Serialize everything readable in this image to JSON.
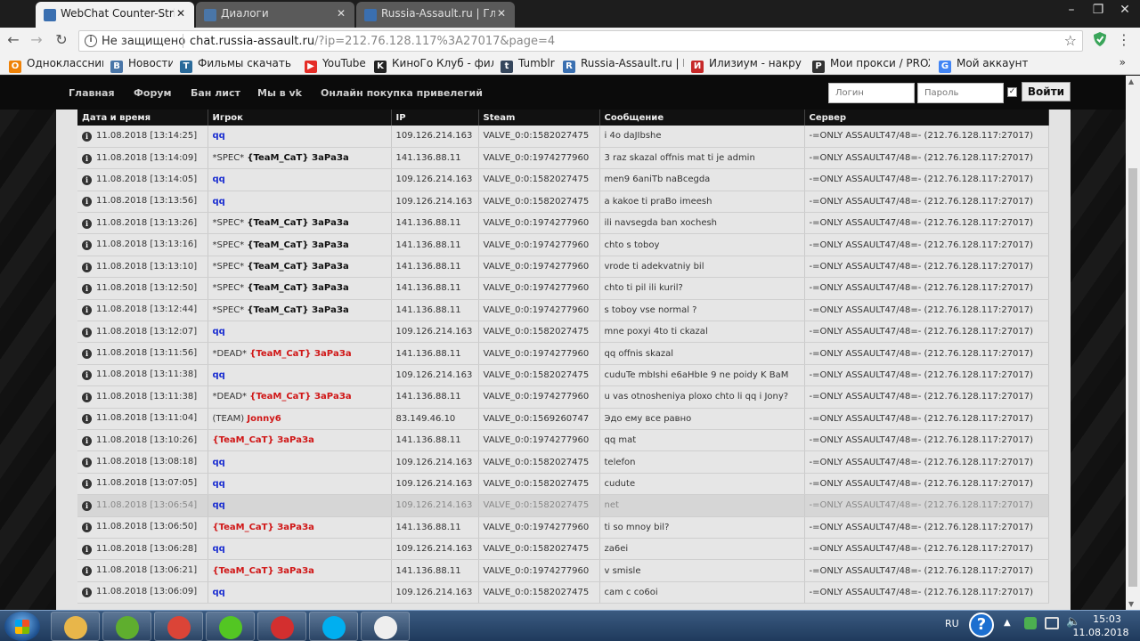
{
  "browser": {
    "tabs": [
      {
        "title": "WebChat Counter-Strike",
        "active": true,
        "favicon_color": "#3a6fb0"
      },
      {
        "title": "Диалоги",
        "active": false,
        "favicon_color": "#4a76a8"
      },
      {
        "title": "Russia-Assault.ru | Глав",
        "active": false,
        "favicon_color": "#3a6fb0"
      }
    ],
    "address": {
      "security": "Не защищено",
      "host": "chat.russia-assault.ru",
      "path": "/?ip=212.76.128.117%3A27017&page=4"
    },
    "bookmarks": [
      {
        "label": "Одноклассники",
        "color": "#ee8208",
        "glyph": "О"
      },
      {
        "label": "Новости",
        "color": "#4a76a8",
        "glyph": "В"
      },
      {
        "label": "Фильмы скачать тор",
        "color": "#2a6a9a",
        "glyph": "T"
      },
      {
        "label": "YouTube",
        "color": "#e52d27",
        "glyph": "▶"
      },
      {
        "label": "КиноГо Клуб - филь",
        "color": "#222222",
        "glyph": "K"
      },
      {
        "label": "Tumblr",
        "color": "#35465c",
        "glyph": "t"
      },
      {
        "label": "Russia-Assault.ru | Мс",
        "color": "#3a6fb0",
        "glyph": "R"
      },
      {
        "label": "Илизиум - накрутка",
        "color": "#c62828",
        "glyph": "И"
      },
      {
        "label": "Мои прокси / PROXY",
        "color": "#333333",
        "glyph": "P"
      },
      {
        "label": "Мой аккаунт",
        "color": "#4285f4",
        "glyph": "G"
      }
    ],
    "bookmarks_more": "»"
  },
  "site": {
    "nav": [
      "Главная",
      "Форум",
      "Бан лист",
      "Мы в vk",
      "Онлайн покупка привелегий"
    ],
    "login_placeholder": "Логин",
    "password_placeholder": "Пароль",
    "login_button": "Войти"
  },
  "table": {
    "headers": [
      "Дата и время",
      "Игрок",
      "IP",
      "Steam",
      "Сообщение",
      "Сервер"
    ],
    "rows": [
      {
        "time": "11.08.2018 [13:14:25]",
        "prefix": "",
        "player": "qq",
        "color": "blue",
        "ip": "109.126.214.163",
        "steam": "VALVE_0:0:1582027475",
        "msg": "i 4o daJIbshe",
        "server": "-=ONLY ASSAULT47/48=- (212.76.128.117:27017)"
      },
      {
        "time": "11.08.2018 [13:14:09]",
        "prefix": "*SPEC* ",
        "player": "{TeaM_CaT} ЗаРаЗа",
        "color": "black",
        "ip": "141.136.88.11",
        "steam": "VALVE_0:0:1974277960",
        "msg": "3 raz skazal offnis mat ti je admin",
        "server": "-=ONLY ASSAULT47/48=- (212.76.128.117:27017)"
      },
      {
        "time": "11.08.2018 [13:14:05]",
        "prefix": "",
        "player": "qq",
        "color": "blue",
        "ip": "109.126.214.163",
        "steam": "VALVE_0:0:1582027475",
        "msg": "men9 6aniTb naBcegda",
        "server": "-=ONLY ASSAULT47/48=- (212.76.128.117:27017)"
      },
      {
        "time": "11.08.2018 [13:13:56]",
        "prefix": "",
        "player": "qq",
        "color": "blue",
        "ip": "109.126.214.163",
        "steam": "VALVE_0:0:1582027475",
        "msg": "a kakoe ti praBo imeesh",
        "server": "-=ONLY ASSAULT47/48=- (212.76.128.117:27017)"
      },
      {
        "time": "11.08.2018 [13:13:26]",
        "prefix": "*SPEC* ",
        "player": "{TeaM_CaT} ЗаРаЗа",
        "color": "black",
        "ip": "141.136.88.11",
        "steam": "VALVE_0:0:1974277960",
        "msg": "ili navsegda ban xochesh",
        "server": "-=ONLY ASSAULT47/48=- (212.76.128.117:27017)"
      },
      {
        "time": "11.08.2018 [13:13:16]",
        "prefix": "*SPEC* ",
        "player": "{TeaM_CaT} ЗаРаЗа",
        "color": "black",
        "ip": "141.136.88.11",
        "steam": "VALVE_0:0:1974277960",
        "msg": "chto s toboy",
        "server": "-=ONLY ASSAULT47/48=- (212.76.128.117:27017)"
      },
      {
        "time": "11.08.2018 [13:13:10]",
        "prefix": "*SPEC* ",
        "player": "{TeaM_CaT} ЗаРаЗа",
        "color": "black",
        "ip": "141.136.88.11",
        "steam": "VALVE_0:0:1974277960",
        "msg": "vrode ti adekvatniy bil",
        "server": "-=ONLY ASSAULT47/48=- (212.76.128.117:27017)"
      },
      {
        "time": "11.08.2018 [13:12:50]",
        "prefix": "*SPEC* ",
        "player": "{TeaM_CaT} ЗаРаЗа",
        "color": "black",
        "ip": "141.136.88.11",
        "steam": "VALVE_0:0:1974277960",
        "msg": "chto ti pil ili kuril?",
        "server": "-=ONLY ASSAULT47/48=- (212.76.128.117:27017)"
      },
      {
        "time": "11.08.2018 [13:12:44]",
        "prefix": "*SPEC* ",
        "player": "{TeaM_CaT} ЗаРаЗа",
        "color": "black",
        "ip": "141.136.88.11",
        "steam": "VALVE_0:0:1974277960",
        "msg": "s toboy vse normal ?",
        "server": "-=ONLY ASSAULT47/48=- (212.76.128.117:27017)"
      },
      {
        "time": "11.08.2018 [13:12:07]",
        "prefix": "",
        "player": "qq",
        "color": "blue",
        "ip": "109.126.214.163",
        "steam": "VALVE_0:0:1582027475",
        "msg": "mne poxyi 4to ti ckazal",
        "server": "-=ONLY ASSAULT47/48=- (212.76.128.117:27017)"
      },
      {
        "time": "11.08.2018 [13:11:56]",
        "prefix": "*DEAD* ",
        "player": "{TeaM_CaT} ЗаРаЗа",
        "color": "red",
        "ip": "141.136.88.11",
        "steam": "VALVE_0:0:1974277960",
        "msg": "qq offnis skazal",
        "server": "-=ONLY ASSAULT47/48=- (212.76.128.117:27017)"
      },
      {
        "time": "11.08.2018 [13:11:38]",
        "prefix": "",
        "player": "qq",
        "color": "blue",
        "ip": "109.126.214.163",
        "steam": "VALVE_0:0:1582027475",
        "msg": "cuduTe mbIshi e6aHbIe 9 ne poidy K BaM",
        "server": "-=ONLY ASSAULT47/48=- (212.76.128.117:27017)"
      },
      {
        "time": "11.08.2018 [13:11:38]",
        "prefix": "*DEAD* ",
        "player": "{TeaM_CaT} ЗаРаЗа",
        "color": "red",
        "ip": "141.136.88.11",
        "steam": "VALVE_0:0:1974277960",
        "msg": "u vas otnosheniya ploxo chto li qq i Jony?",
        "server": "-=ONLY ASSAULT47/48=- (212.76.128.117:27017)"
      },
      {
        "time": "11.08.2018 [13:11:04]",
        "prefix": "(TEAM) ",
        "player": "Jonny6",
        "color": "red",
        "ip": "83.149.46.10",
        "steam": "VALVE_0:0:1569260747",
        "msg": "Эдо ему все равно",
        "server": "-=ONLY ASSAULT47/48=- (212.76.128.117:27017)"
      },
      {
        "time": "11.08.2018 [13:10:26]",
        "prefix": "",
        "player": "{TeaM_CaT} ЗаРаЗа",
        "color": "red",
        "ip": "141.136.88.11",
        "steam": "VALVE_0:0:1974277960",
        "msg": "qq mat",
        "server": "-=ONLY ASSAULT47/48=- (212.76.128.117:27017)"
      },
      {
        "time": "11.08.2018 [13:08:18]",
        "prefix": "",
        "player": "qq",
        "color": "blue",
        "ip": "109.126.214.163",
        "steam": "VALVE_0:0:1582027475",
        "msg": "telefon",
        "server": "-=ONLY ASSAULT47/48=- (212.76.128.117:27017)"
      },
      {
        "time": "11.08.2018 [13:07:05]",
        "prefix": "",
        "player": "qq",
        "color": "blue",
        "ip": "109.126.214.163",
        "steam": "VALVE_0:0:1582027475",
        "msg": "cudute",
        "server": "-=ONLY ASSAULT47/48=- (212.76.128.117:27017)"
      },
      {
        "time": "11.08.2018 [13:06:54]",
        "prefix": "",
        "player": "qq",
        "color": "blue",
        "ip": "109.126.214.163",
        "steam": "VALVE_0:0:1582027475",
        "msg": "net",
        "server": "-=ONLY ASSAULT47/48=- (212.76.128.117:27017)",
        "highlight": true
      },
      {
        "time": "11.08.2018 [13:06:50]",
        "prefix": "",
        "player": "{TeaM_CaT} ЗаРаЗа",
        "color": "red",
        "ip": "141.136.88.11",
        "steam": "VALVE_0:0:1974277960",
        "msg": "ti so mnoy bil?",
        "server": "-=ONLY ASSAULT47/48=- (212.76.128.117:27017)"
      },
      {
        "time": "11.08.2018 [13:06:28]",
        "prefix": "",
        "player": "qq",
        "color": "blue",
        "ip": "109.126.214.163",
        "steam": "VALVE_0:0:1582027475",
        "msg": "za6ei",
        "server": "-=ONLY ASSAULT47/48=- (212.76.128.117:27017)"
      },
      {
        "time": "11.08.2018 [13:06:21]",
        "prefix": "",
        "player": "{TeaM_CaT} ЗаРаЗа",
        "color": "red",
        "ip": "141.136.88.11",
        "steam": "VALVE_0:0:1974277960",
        "msg": "v smisle",
        "server": "-=ONLY ASSAULT47/48=- (212.76.128.117:27017)"
      },
      {
        "time": "11.08.2018 [13:06:09]",
        "prefix": "",
        "player": "qq",
        "color": "blue",
        "ip": "109.126.214.163",
        "steam": "VALVE_0:0:1582027475",
        "msg": "cam c co6oi",
        "server": "-=ONLY ASSAULT47/48=- (212.76.128.117:27017)"
      }
    ]
  },
  "taskbar": {
    "apps": [
      {
        "name": "explorer",
        "color": "#e8b64a"
      },
      {
        "name": "utorrent",
        "color": "#5fae2e"
      },
      {
        "name": "chrome",
        "color": "#db4437"
      },
      {
        "name": "icq",
        "color": "#53c623"
      },
      {
        "name": "apple-app",
        "color": "#d32f2f"
      },
      {
        "name": "skype",
        "color": "#00aff0"
      },
      {
        "name": "counter-strike",
        "color": "#eeeeee"
      }
    ],
    "lang": "RU",
    "time": "15:03",
    "date": "11.08.2018"
  }
}
